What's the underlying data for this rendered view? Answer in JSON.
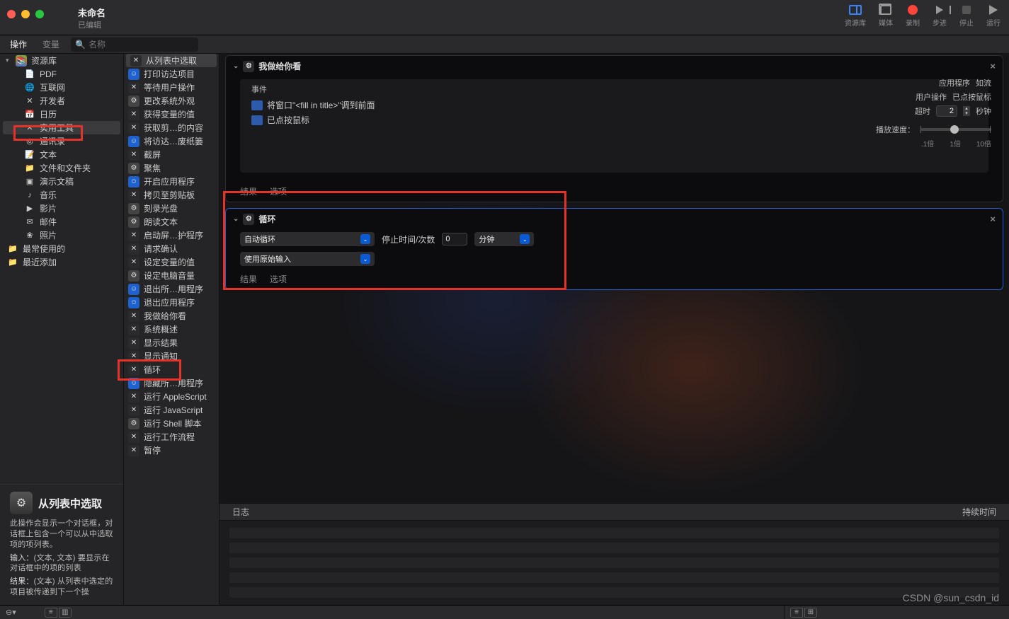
{
  "title": {
    "main": "未命名",
    "sub": "已编辑"
  },
  "toolbar_right": {
    "library": "资源库",
    "media": "媒体",
    "record": "录制",
    "step": "步进",
    "stop": "停止",
    "run": "运行"
  },
  "secondbar": {
    "tab_actions": "操作",
    "tab_vars": "变量",
    "search_placeholder": "名称"
  },
  "sidebar": {
    "root": "资源库",
    "items": [
      {
        "label": "PDF",
        "icon": "📄"
      },
      {
        "label": "互联网",
        "icon": "🌐"
      },
      {
        "label": "开发者",
        "icon": "✕"
      },
      {
        "label": "日历",
        "icon": "📅"
      },
      {
        "label": "实用工具",
        "icon": "✕",
        "selected": true
      },
      {
        "label": "通讯录",
        "icon": "◎"
      },
      {
        "label": "文本",
        "icon": "📝"
      },
      {
        "label": "文件和文件夹",
        "icon": "📁"
      },
      {
        "label": "演示文稿",
        "icon": "▣"
      },
      {
        "label": "音乐",
        "icon": "♪"
      },
      {
        "label": "影片",
        "icon": "▶"
      },
      {
        "label": "邮件",
        "icon": "✉"
      },
      {
        "label": "照片",
        "icon": "❀"
      }
    ],
    "folders": [
      {
        "label": "最常使用的"
      },
      {
        "label": "最近添加"
      }
    ]
  },
  "actions": [
    {
      "label": "从列表中选取",
      "icon": "wrench",
      "selected": true
    },
    {
      "label": "打印访达项目",
      "icon": "blue"
    },
    {
      "label": "等待用户操作",
      "icon": "wrench"
    },
    {
      "label": "更改系统外观",
      "icon": "gear"
    },
    {
      "label": "获得变量的值",
      "icon": "wrench"
    },
    {
      "label": "获取剪…的内容",
      "icon": "wrench"
    },
    {
      "label": "将访达…废纸篓",
      "icon": "blue"
    },
    {
      "label": "截屏",
      "icon": "wrench"
    },
    {
      "label": "聚焦",
      "icon": "gear"
    },
    {
      "label": "开启应用程序",
      "icon": "blue"
    },
    {
      "label": "拷贝至剪贴板",
      "icon": "wrench"
    },
    {
      "label": "刻录光盘",
      "icon": "gear"
    },
    {
      "label": "朗读文本",
      "icon": "gear"
    },
    {
      "label": "启动屏…护程序",
      "icon": "wrench"
    },
    {
      "label": "请求确认",
      "icon": "wrench"
    },
    {
      "label": "设定变量的值",
      "icon": "wrench"
    },
    {
      "label": "设定电脑音量",
      "icon": "gear"
    },
    {
      "label": "退出所…用程序",
      "icon": "blue"
    },
    {
      "label": "退出应用程序",
      "icon": "blue"
    },
    {
      "label": "我做给你看",
      "icon": "wrench"
    },
    {
      "label": "系统概述",
      "icon": "wrench"
    },
    {
      "label": "显示结果",
      "icon": "wrench"
    },
    {
      "label": "显示通知",
      "icon": "wrench"
    },
    {
      "label": "循环",
      "icon": "wrench"
    },
    {
      "label": "隐藏所…用程序",
      "icon": "blue"
    },
    {
      "label": "运行 AppleScript",
      "icon": "wrench"
    },
    {
      "label": "运行 JavaScript",
      "icon": "wrench"
    },
    {
      "label": "运行 Shell 脚本",
      "icon": "gear"
    },
    {
      "label": "运行工作流程",
      "icon": "wrench"
    },
    {
      "label": "暂停",
      "icon": "wrench"
    }
  ],
  "workflow": {
    "block1": {
      "title": "我做给你看",
      "events_label": "事件",
      "rows": [
        "将窗口\"<fill in title>\"调到前面",
        "已点按鼠标"
      ],
      "footer": {
        "results": "结果",
        "options": "选项"
      },
      "right": {
        "app_k": "应用程序",
        "app_v": "如流",
        "user_k": "用户操作",
        "user_v": "已点按鼠标",
        "timeout_k": "超时",
        "timeout_v": "2",
        "timeout_u": "秒钟",
        "speed_k": "播放速度：",
        "ticks": [
          ".1倍",
          "1倍",
          "10倍"
        ]
      }
    },
    "block2": {
      "title": "循环",
      "drop1": "自动循环",
      "stop_label": "停止时间/次数",
      "stop_value": "0",
      "unit": "分钟",
      "drop2": "使用原始输入",
      "footer": {
        "results": "结果",
        "options": "选项"
      }
    }
  },
  "log": {
    "title": "日志",
    "duration": "持续时间"
  },
  "info": {
    "title": "从列表中选取",
    "desc": "此操作会显示一个对话框，对话框上包含一个可以从中选取项的项列表。",
    "input_k": "输入：",
    "input_v": "(文本, 文本) 要显示在对话框中的项的列表",
    "result_k": "结果：",
    "result_v": "(文本) 从列表中选定的项目被传递到下一个操"
  },
  "watermark": "CSDN @sun_csdn_id",
  "status": {
    "sym": "⊖▾"
  }
}
